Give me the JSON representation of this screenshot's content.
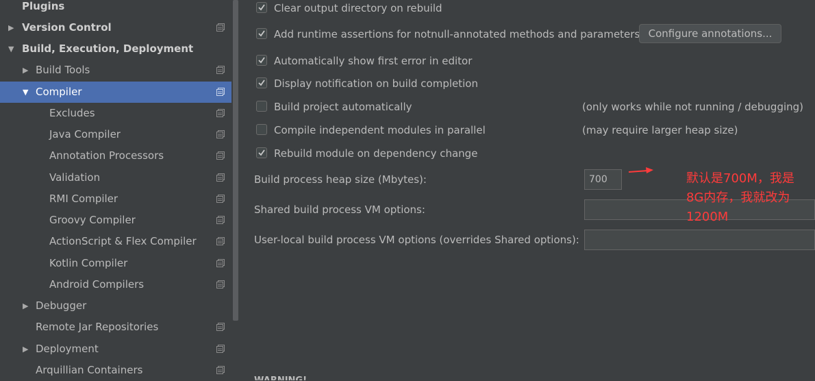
{
  "sidebar": {
    "items": [
      {
        "label": "Plugins"
      },
      {
        "label": "Version Control"
      },
      {
        "label": "Build, Execution, Deployment"
      },
      {
        "label": "Build Tools"
      },
      {
        "label": "Compiler"
      },
      {
        "label": "Excludes"
      },
      {
        "label": "Java Compiler"
      },
      {
        "label": "Annotation Processors"
      },
      {
        "label": "Validation"
      },
      {
        "label": "RMI Compiler"
      },
      {
        "label": "Groovy Compiler"
      },
      {
        "label": "ActionScript & Flex Compiler"
      },
      {
        "label": "Kotlin Compiler"
      },
      {
        "label": "Android Compilers"
      },
      {
        "label": "Debugger"
      },
      {
        "label": "Remote Jar Repositories"
      },
      {
        "label": "Deployment"
      },
      {
        "label": "Arquillian Containers"
      }
    ]
  },
  "compiler": {
    "checkboxes": [
      {
        "label": "Clear output directory on rebuild",
        "checked": true
      },
      {
        "label": "Add runtime assertions for notnull-annotated methods and parameters",
        "checked": true
      },
      {
        "label": "Automatically show first error in editor",
        "checked": true
      },
      {
        "label": "Display notification on build completion",
        "checked": true
      },
      {
        "label": "Build project automatically",
        "checked": false
      },
      {
        "label": "Compile independent modules in parallel",
        "checked": false
      },
      {
        "label": "Rebuild module on dependency change",
        "checked": true
      }
    ],
    "configure_button": "Configure annotations...",
    "notes": {
      "build_auto": "(only works while not running / debugging)",
      "parallel": "(may require larger heap size)"
    },
    "heap_label": "Build process heap size (Mbytes):",
    "heap_value": "700",
    "shared_vm_label": "Shared build process VM options:",
    "shared_vm_value": "",
    "user_vm_label": "User-local build process VM options (overrides Shared options):",
    "user_vm_value": "",
    "cut_off_heading": "WARNING!"
  },
  "annotation": {
    "line1": "默认是700M，我是",
    "line2": "8G内存，我就改为",
    "line3": "1200M",
    "color": "#ff3b3b"
  },
  "colors": {
    "background": "#3c3f41",
    "selection": "#4b6eaf",
    "text": "#bbbbbb"
  }
}
